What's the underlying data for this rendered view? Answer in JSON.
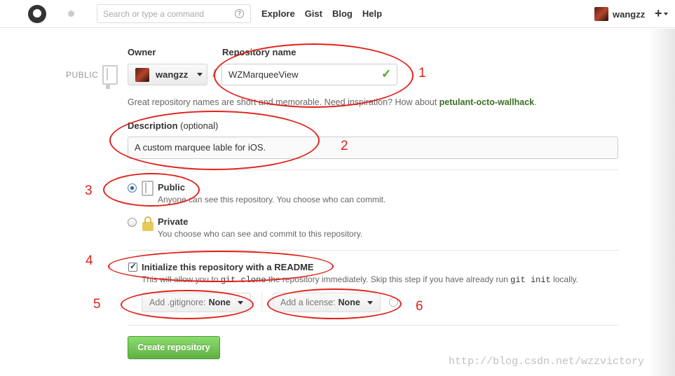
{
  "header": {
    "search_placeholder": "Search or type a command",
    "help_symbol": "?",
    "nav": [
      "Explore",
      "Gist",
      "Blog",
      "Help"
    ],
    "username": "wangzz",
    "plus_symbol": "+"
  },
  "form": {
    "public_badge": "PUBLIC",
    "owner_label": "Owner",
    "owner_value": "wangzz",
    "slash": "/",
    "repo_name_label": "Repository name",
    "repo_name_value": "WZMarqueeView",
    "valid_mark": "✓",
    "hint_text": "Great repository names are short and memorable. Need inspiration? How about ",
    "hint_suggestion": "petulant-octo-wallhack",
    "hint_end": ".",
    "description_label": "Description",
    "description_optional": "(optional)",
    "description_value": "A custom marquee lable for iOS.",
    "visibility": {
      "selected": "Public",
      "public_title": "Public",
      "public_desc": "Anyone can see this repository. You choose who can commit.",
      "private_title": "Private",
      "private_desc": "You choose who can see and commit to this repository."
    },
    "readme": {
      "checked": true,
      "label": "Initialize this repository with a README",
      "desc_1": "This will allow you to ",
      "desc_code_1": "git clone",
      "desc_2": " the repository immediately. Skip this step if you have already run ",
      "desc_code_2": "git init",
      "desc_3": " locally."
    },
    "gitignore": {
      "prefix": "Add .gitignore:",
      "value": "None"
    },
    "license": {
      "prefix": "Add a license:",
      "value": "None"
    },
    "submit_label": "Create repository"
  },
  "annotations": {
    "color": "#e0221a",
    "numbers": [
      "1",
      "2",
      "3",
      "4",
      "5",
      "6"
    ]
  },
  "watermark": "http://blog.csdn.net/wzzvictory"
}
